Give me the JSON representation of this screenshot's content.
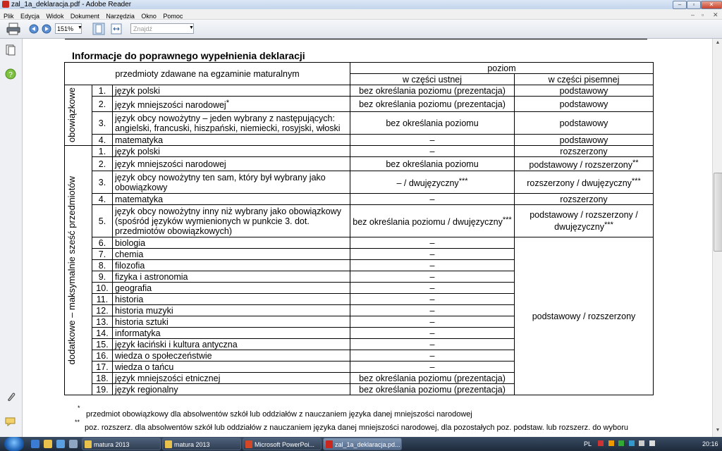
{
  "window": {
    "title": "zal_1a_deklaracja.pdf - Adobe Reader",
    "minimize": "–",
    "restore": "▫",
    "close": "✕"
  },
  "menu": [
    "Plik",
    "Edycja",
    "Widok",
    "Dokument",
    "Narzędzia",
    "Okno",
    "Pomoc"
  ],
  "toolbar": {
    "zoom": "151%",
    "find_placeholder": "Znajdź"
  },
  "document": {
    "heading": "Informacje do poprawnego wypełnienia deklaracji",
    "header": {
      "subjects": "przedmioty zdawane na egzaminie maturalnym",
      "level": "poziom",
      "oral": "w części ustnej",
      "written": "w części pisemnej"
    },
    "group1_label": "obowiązkowe",
    "group2_label": "dodatkowe – maksymalnie  sześć przedmiotów",
    "group2_shared_written": "podstawowy / rozszerzony",
    "rows_mandatory": [
      {
        "n": "1.",
        "subject": "język polski",
        "sup": "",
        "oral": "bez określania poziomu (prezentacja)",
        "oral_sup": "",
        "written": "podstawowy",
        "written_sup": ""
      },
      {
        "n": "2.",
        "subject": "język mniejszości narodowej",
        "sup": "*",
        "oral": "bez określania poziomu (prezentacja)",
        "oral_sup": "",
        "written": "podstawowy",
        "written_sup": ""
      },
      {
        "n": "3.",
        "subject": "język obcy nowożytny – jeden wybrany z następujących: angielski, francuski, hiszpański, niemiecki, rosyjski, włoski",
        "sup": "",
        "oral": "bez określania poziomu",
        "oral_sup": "",
        "written": "podstawowy",
        "written_sup": ""
      },
      {
        "n": "4.",
        "subject": "matematyka",
        "sup": "",
        "oral": "–",
        "oral_sup": "",
        "written": "podstawowy",
        "written_sup": ""
      }
    ],
    "rows_additional_top": [
      {
        "n": "1.",
        "subject": "język polski",
        "oral": "–",
        "oral_sup": "",
        "written": "rozszerzony",
        "written_sup": ""
      },
      {
        "n": "2.",
        "subject": "język mniejszości narodowej",
        "oral": "bez określania poziomu",
        "oral_sup": "",
        "written": "podstawowy / rozszerzony",
        "written_sup": "**"
      },
      {
        "n": "3.",
        "subject": "język obcy nowożytny ten sam, który był wybrany jako obowiązkowy",
        "oral": "– / dwujęzyczny",
        "oral_sup": "***",
        "written": "rozszerzony / dwujęzyczny",
        "written_sup": "***"
      },
      {
        "n": "4.",
        "subject": "matematyka",
        "oral": "–",
        "oral_sup": "",
        "written": "rozszerzony",
        "written_sup": ""
      },
      {
        "n": "5.",
        "subject": "język obcy nowożytny inny niż wybrany jako obowiązkowy (spośród języków wymienionych w punkcie 3. dot. przedmiotów obowiązkowych)",
        "oral": "bez określania poziomu / dwujęzyczny",
        "oral_sup": "***",
        "written": "podstawowy / rozszerzony / dwujęzyczny",
        "written_sup": "***"
      }
    ],
    "rows_additional_rest": [
      {
        "n": "6.",
        "subject": "biologia",
        "oral": "–"
      },
      {
        "n": "7.",
        "subject": "chemia",
        "oral": "–"
      },
      {
        "n": "8.",
        "subject": "filozofia",
        "oral": "–"
      },
      {
        "n": "9.",
        "subject": "fizyka i astronomia",
        "oral": "–"
      },
      {
        "n": "10.",
        "subject": "geografia",
        "oral": "–"
      },
      {
        "n": "11.",
        "subject": "historia",
        "oral": "–"
      },
      {
        "n": "12.",
        "subject": "historia muzyki",
        "oral": "–"
      },
      {
        "n": "13.",
        "subject": "historia sztuki",
        "oral": "–"
      },
      {
        "n": "14.",
        "subject": "informatyka",
        "oral": "–"
      },
      {
        "n": "15.",
        "subject": "język łaciński i kultura antyczna",
        "oral": "–"
      },
      {
        "n": "16.",
        "subject": "wiedza o społeczeństwie",
        "oral": "–"
      },
      {
        "n": "17.",
        "subject": "wiedza o tańcu",
        "oral": "–"
      },
      {
        "n": "18.",
        "subject": "język mniejszości etnicznej",
        "oral": "bez określania poziomu (prezentacja)"
      },
      {
        "n": "19.",
        "subject": "język regionalny",
        "oral": "bez określania poziomu (prezentacja)"
      }
    ],
    "footnotes": [
      {
        "mark": "*",
        "text": "przedmiot obowiązkowy dla absolwentów szkół lub oddziałów z nauczaniem języka danej mniejszości narodowej"
      },
      {
        "mark": "**",
        "text": "poz. rozszerz. dla absolwentów szkół lub oddziałów z  nauczaniem języka danej mniejszości narodowej, dla pozostałych poz. podstaw. lub rozszerz. do wyboru"
      }
    ]
  },
  "taskbar": {
    "tasks": [
      {
        "label": "matura 2013",
        "color": "#e8c24a"
      },
      {
        "label": "matura 2013",
        "color": "#e8c24a"
      },
      {
        "label": "Microsoft PowerPoi...",
        "color": "#d24726"
      },
      {
        "label": "zal_1a_deklaracja.pd...",
        "color": "#c8281e"
      }
    ],
    "lang": "PL",
    "clock": "20:16"
  }
}
